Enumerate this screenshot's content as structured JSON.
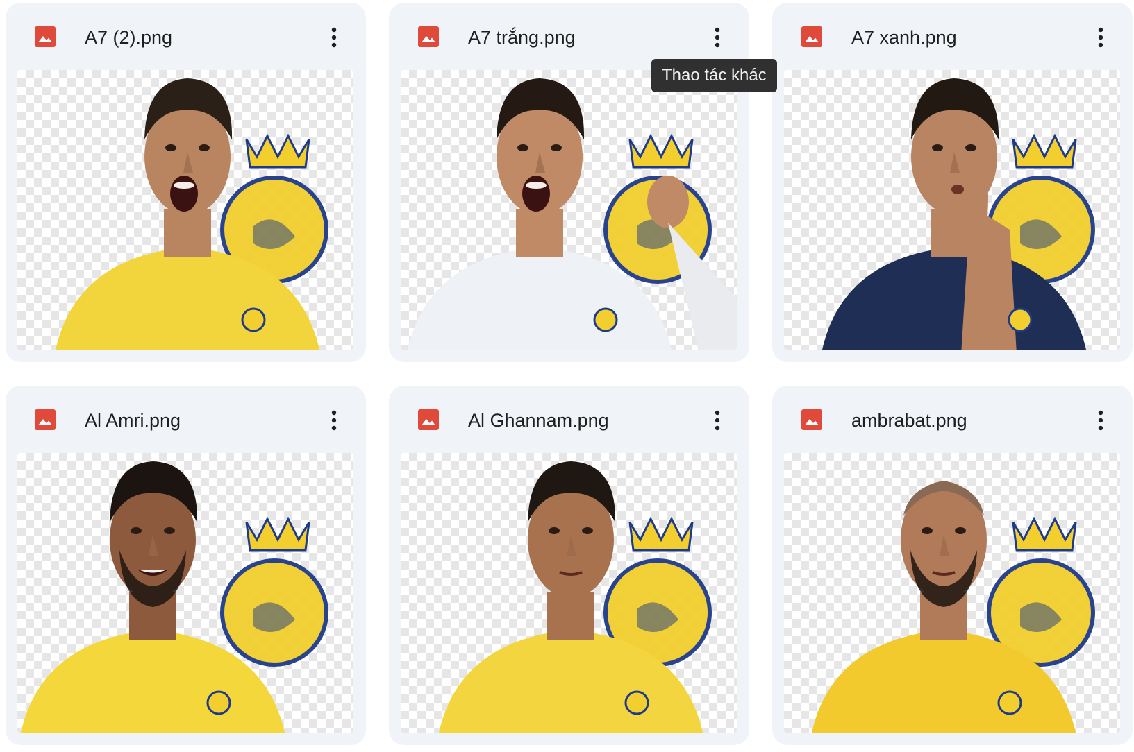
{
  "files": [
    {
      "name": "A7 (2).png",
      "jersey": "#f2d53c",
      "skin": "#b98560",
      "hair": "#2a2017",
      "expression": "shout"
    },
    {
      "name": "A7 trắng.png",
      "jersey": "#eef1f6",
      "skin": "#c08a66",
      "hair": "#241a13",
      "expression": "shout"
    },
    {
      "name": "A7 xanh.png",
      "jersey": "#1f2e55",
      "skin": "#b88462",
      "hair": "#221913",
      "expression": "shush"
    },
    {
      "name": "Al Amri.png",
      "jersey": "#f4d73a",
      "skin": "#8e5a3e",
      "hair": "#1b1410",
      "expression": "smile"
    },
    {
      "name": "Al Ghannam.png",
      "jersey": "#f3d63f",
      "skin": "#a8724f",
      "hair": "#1f1712",
      "expression": "neutral"
    },
    {
      "name": "ambrabat.png",
      "jersey": "#f2ca2d",
      "skin": "#b17a58",
      "hair": "#8a6a55",
      "expression": "neutral"
    }
  ],
  "tooltip": {
    "text": "Thao tác khác"
  },
  "icons": {
    "file_type": "image-file-icon",
    "more": "more-vert-icon"
  },
  "colors": {
    "file_icon": "#e04a3a",
    "crest_gold": "#f2cf2e",
    "crest_blue": "#1e3a8a"
  }
}
